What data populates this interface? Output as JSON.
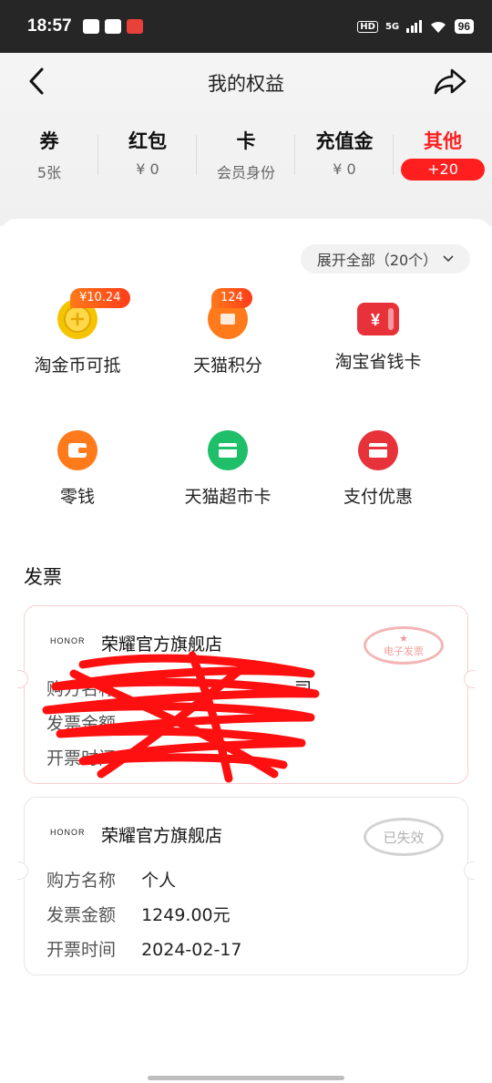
{
  "status_bar": {
    "time": "18:57",
    "hd": "HD",
    "network": "5G",
    "battery": "96"
  },
  "header": {
    "title": "我的权益",
    "back_icon": "chevron-left-icon",
    "share_icon": "share-icon"
  },
  "tabs": [
    {
      "name": "券",
      "sub": "5张"
    },
    {
      "name": "红包",
      "sub": "¥ 0"
    },
    {
      "name": "卡",
      "sub": "会员身份"
    },
    {
      "name": "充值金",
      "sub": "¥ 0"
    },
    {
      "name": "其他",
      "badge": "+20"
    }
  ],
  "expand": {
    "label": "展开全部（20个）"
  },
  "benefits": [
    {
      "label": "淘金币可抵",
      "badge": "¥10.24",
      "icon": "gold-coin-icon",
      "color": "#f5c400"
    },
    {
      "label": "天猫积分",
      "badge": "124",
      "icon": "points-icon",
      "color": "#ff7a1a"
    },
    {
      "label": "淘宝省钱卡",
      "icon": "savings-card-icon",
      "color": "#e8323a"
    },
    {
      "label": "零钱",
      "icon": "wallet-icon",
      "color": "#ff7a1a"
    },
    {
      "label": "天猫超市卡",
      "icon": "supermarket-card-icon",
      "color": "#1fbf6a"
    },
    {
      "label": "支付优惠",
      "icon": "pay-discount-icon",
      "color": "#e8323a"
    }
  ],
  "invoice_section": {
    "title": "发票"
  },
  "invoices": [
    {
      "brand": "HONOR",
      "store": "荣耀官方旗舰店",
      "stamp": "电子发票",
      "rows": [
        {
          "label": "购方名称",
          "value": "司"
        },
        {
          "label": "发票金额",
          "value": ""
        },
        {
          "label": "开票时间",
          "value": ""
        }
      ],
      "redacted": true
    },
    {
      "brand": "HONOR",
      "store": "荣耀官方旗舰店",
      "stamp": "已失效",
      "rows": [
        {
          "label": "购方名称",
          "value": "个人"
        },
        {
          "label": "发票金额",
          "value": "1249.00元"
        },
        {
          "label": "开票时间",
          "value": "2024-02-17"
        }
      ]
    }
  ]
}
